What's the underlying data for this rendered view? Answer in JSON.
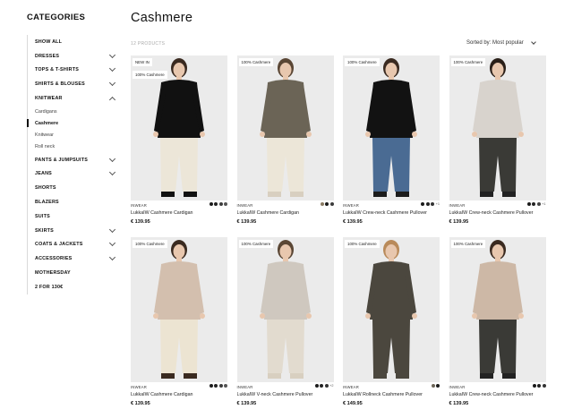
{
  "sidebar": {
    "title": "CATEGORIES",
    "items": [
      {
        "label": "SHOW ALL",
        "chev": ""
      },
      {
        "label": "DRESSES",
        "chev": "down"
      },
      {
        "label": "TOPS & T-SHIRTS",
        "chev": "down"
      },
      {
        "label": "SHIRTS & BLOUSES",
        "chev": "down"
      },
      {
        "label": "KNITWEAR",
        "chev": "up"
      },
      {
        "label": "PANTS & JUMPSUITS",
        "chev": "down"
      },
      {
        "label": "JEANS",
        "chev": "down"
      },
      {
        "label": "SHORTS",
        "chev": ""
      },
      {
        "label": "BLAZERS",
        "chev": ""
      },
      {
        "label": "SUITS",
        "chev": ""
      },
      {
        "label": "SKIRTS",
        "chev": "down"
      },
      {
        "label": "COATS & JACKETS",
        "chev": "down"
      },
      {
        "label": "ACCESSORIES",
        "chev": "down"
      },
      {
        "label": "MOTHERSDAY",
        "chev": ""
      },
      {
        "label": "2 FOR 130€",
        "chev": ""
      }
    ],
    "knitwear_sub": [
      "Cardigans",
      "Cashmere",
      "Knitwear",
      "Roll neck"
    ]
  },
  "main": {
    "title": "Cashmere",
    "count": "12 PRODUCTS",
    "sort_label": "Sorted by: Most popular"
  },
  "colors": {
    "accent": "#111111",
    "photo_bg": "#ebebeb"
  },
  "products": [
    {
      "badges": [
        "NEW IN",
        "100% Cashmere"
      ],
      "brand": "INWEAR",
      "name": "LukkaIW Cashmere Cardigan",
      "price": "€ 139.95",
      "swatches": [
        "#1a1a1a",
        "#222",
        "#3b3b3b",
        "#555"
      ],
      "more": "",
      "figure": {
        "top": "#111111",
        "bottom": "#ece6d8",
        "skin": "#e8c7ae",
        "hair": "#3a2a20",
        "shoe": "#111111"
      }
    },
    {
      "badges": [
        "100% Cashmere"
      ],
      "brand": "INWEAR",
      "name": "LukkaIW Cashmere Cardigan",
      "price": "€ 139.95",
      "swatches": [
        "#8a7a62",
        "#1a1a1a",
        "#3b3b3b"
      ],
      "more": "",
      "figure": {
        "top": "#6b6456",
        "bottom": "#ece6d8",
        "skin": "#e8c7ae",
        "hair": "#5a4634",
        "shoe": "#d8cfc0"
      }
    },
    {
      "badges": [
        "100% Cashmere"
      ],
      "brand": "INWEAR",
      "name": "LukkaIW Crew-neck Cashmere Pullover",
      "price": "€ 139.95",
      "swatches": [
        "#1a1a1a",
        "#222",
        "#333"
      ],
      "more": "+1",
      "figure": {
        "top": "#121212",
        "bottom": "#4a6b93",
        "skin": "#e8c7ae",
        "hair": "#3a2a20",
        "shoe": "#1c1c1c"
      }
    },
    {
      "badges": [
        "100% Cashmere"
      ],
      "brand": "INWEAR",
      "name": "LukkaIW Crew-neck Cashmere Pullover",
      "price": "€ 139.95",
      "swatches": [
        "#1a1a1a",
        "#222",
        "#444"
      ],
      "more": "+1",
      "figure": {
        "top": "#d8d3cd",
        "bottom": "#3a3a36",
        "skin": "#e8c7ae",
        "hair": "#2a1f18",
        "shoe": "#222222"
      }
    },
    {
      "badges": [
        "100% Cashmere"
      ],
      "brand": "INWEAR",
      "name": "LukkaIW Cashmere Cardigan",
      "price": "€ 139.95",
      "swatches": [
        "#1a1a1a",
        "#222",
        "#3b3b3b",
        "#555"
      ],
      "more": "",
      "figure": {
        "top": "#d3bfae",
        "bottom": "#ece4d2",
        "skin": "#e8c7ae",
        "hair": "#3a2a20",
        "shoe": "#3a2a20"
      }
    },
    {
      "badges": [
        "100% Cashmere"
      ],
      "brand": "INWEAR",
      "name": "LukkaIW V-neck Cashmere Pullover",
      "price": "€ 139.95",
      "swatches": [
        "#1a1a1a",
        "#222",
        "#333"
      ],
      "more": "+2",
      "figure": {
        "top": "#cfc8bf",
        "bottom": "#e2dbcf",
        "skin": "#e8c7ae",
        "hair": "#5a4634",
        "shoe": "#d8cfc0"
      }
    },
    {
      "badges": [
        "100% Cashmere"
      ],
      "brand": "INWEAR",
      "name": "LukkaIW Rollneck Cashmere Pullover",
      "price": "€ 149.95",
      "swatches": [
        "#6b6456",
        "#1a1a1a"
      ],
      "more": "",
      "figure": {
        "top": "#4b473e",
        "bottom": "#4b473e",
        "skin": "#e8c7ae",
        "hair": "#b98a5a",
        "shoe": "#4b473e"
      }
    },
    {
      "badges": [
        "100% Cashmere"
      ],
      "brand": "INWEAR",
      "name": "LukkaIW Crew-neck Cashmere Pullover",
      "price": "€ 139.95",
      "swatches": [
        "#1a1a1a",
        "#222",
        "#333"
      ],
      "more": "",
      "figure": {
        "top": "#cdb8a6",
        "bottom": "#3a3a36",
        "skin": "#e8c7ae",
        "hair": "#3a2a20",
        "shoe": "#222222"
      }
    }
  ]
}
